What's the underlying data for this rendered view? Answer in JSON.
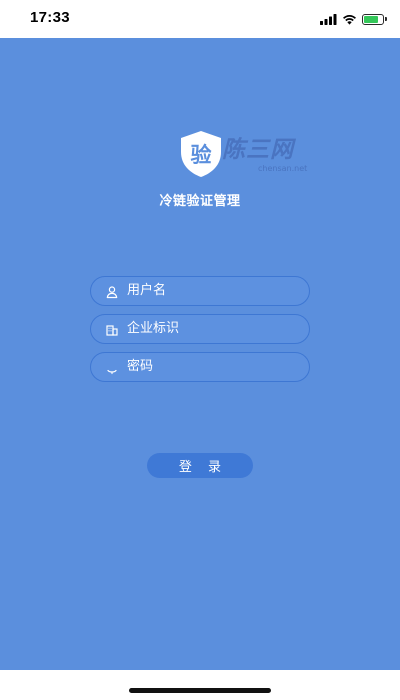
{
  "status_bar": {
    "time": "17:33",
    "battery_level": 0.85,
    "battery_color": "#34c759"
  },
  "logo": {
    "char": "验",
    "icon": "shield-icon",
    "watermark": "陈三网",
    "watermark_sub": "chensan.net"
  },
  "app_title": "冷链验证管理",
  "form": {
    "username": {
      "placeholder": "用户名",
      "icon": "user-icon"
    },
    "enterprise": {
      "placeholder": "企业标识",
      "icon": "building-icon"
    },
    "password": {
      "placeholder": "密码",
      "icon": "lock-icon"
    }
  },
  "login_button": "登 录",
  "colors": {
    "background": "#5b8fdd",
    "field_border": "#3e77d3",
    "button": "#3f79d6",
    "text": "#ffffff"
  }
}
